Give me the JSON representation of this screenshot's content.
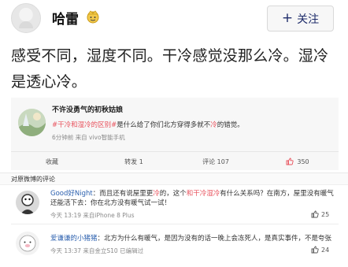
{
  "header": {
    "username": "哈雷",
    "follow_label": "关注"
  },
  "post": {
    "text": "感受不同，湿度不同。干冷感觉没那么冷。湿冷是透心冷。"
  },
  "quote": {
    "author": "不许没勇气的初秋姑娘",
    "body_hashtag": "#干冷和湿冷的区别#",
    "body_rest_1": "是什么给了你们北方穿得多就不",
    "body_red": "冷",
    "body_rest_2": "的错觉。",
    "meta": "6分钟前 来自 vivo智能手机",
    "actions": {
      "repost": "收藏",
      "forward": "转发 1",
      "comment": "评论 107",
      "like": "350"
    }
  },
  "comments_section": {
    "title": "对原微博的评论"
  },
  "comments": [
    {
      "user": "Good好Night",
      "text_1": "：而且还有说屋里更",
      "red_1": "冷",
      "text_2": "的，这个",
      "red_2": "和干冷湿冷",
      "text_3": "有什么关系吗？在南方，屋里没有暖气还能活下去：你在北方没有暖气试一试！",
      "meta": "今天 13:19 来自iPhone 8 Plus",
      "likes": "25"
    },
    {
      "user": "爱谦谦的小猪猪",
      "text": "：北方为什么有暖气，是因为没有的话一晚上会冻死人，是真实事件，不是夸张",
      "meta": "今天 13:37 来自金立S10 已编辑过",
      "likes": "24"
    }
  ],
  "colors": {
    "accent_blue": "#2a5fae",
    "hashtag_red": "#e8505b",
    "follow_text": "#1f2d6b"
  }
}
